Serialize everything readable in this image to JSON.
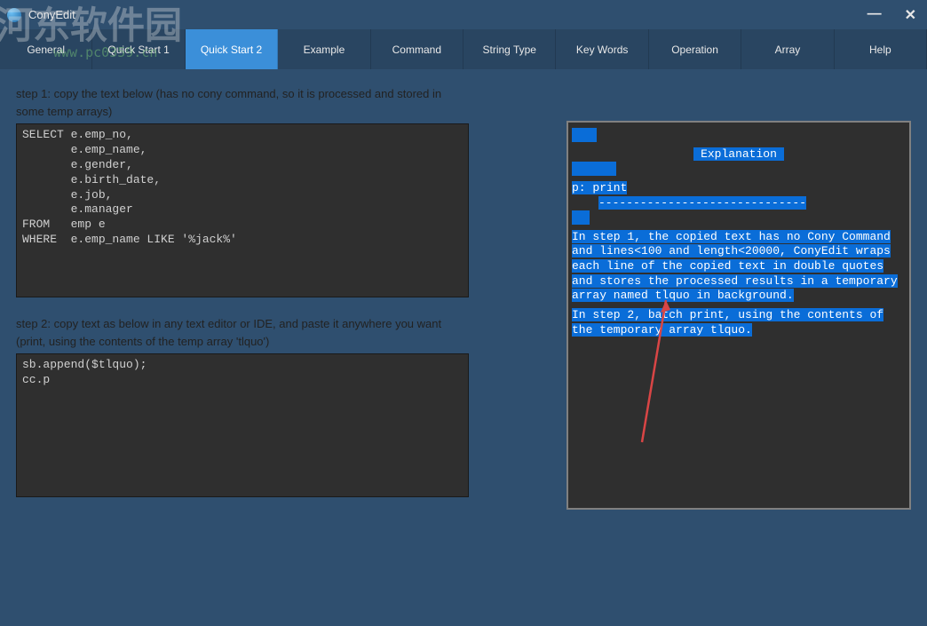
{
  "watermark": {
    "main": "河东软件园",
    "sub": "www.pc0359.cn"
  },
  "title": "ConyEdit",
  "tabs": [
    "General",
    "Quick Start 1",
    "Quick Start 2",
    "Example",
    "Command",
    "String Type",
    "Key Words",
    "Operation",
    "Array",
    "Help"
  ],
  "active_tab_index": 2,
  "step1_label": "step 1: copy the text below (has no cony command, so it is processed and stored in some temp arrays)",
  "code1": "SELECT e.emp_no,\n       e.emp_name,\n       e.gender,\n       e.birth_date,\n       e.job,\n       e.manager\nFROM   emp e\nWHERE  e.emp_name LIKE '%jack%'",
  "step2_label": "step 2: copy text as below in any text editor or IDE, and paste it anywhere you want (print, using the contents of the temp array 'tlquo')",
  "code2": "sb.append($tlquo);\ncc.p",
  "explanation": {
    "header": "Explanation",
    "cmd": "p:  print",
    "sep": "------------------------------",
    "para1": "  In step 1, the copied text has no Cony Command and lines<100 and length<20000, ConyEdit wraps each line of the copied text in double quotes and stores the processed results in a temporary array named tlquo in background.",
    "para2": "  In step 2, batch print, using the contents of the temporary array tlquo."
  }
}
